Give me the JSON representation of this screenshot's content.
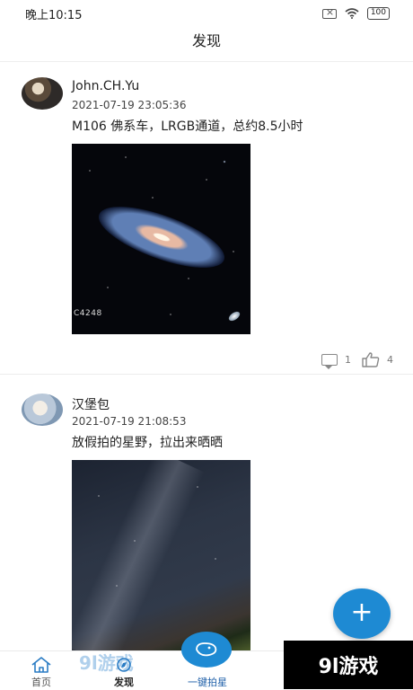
{
  "status_bar": {
    "time": "晚上10:15",
    "battery": "100"
  },
  "header": {
    "title": "发现"
  },
  "posts": [
    {
      "username": "John.CH.Yu",
      "timestamp": "2021-07-19 23:05:36",
      "caption": "M106 佛系车，LRGB通道，总约8.5小时",
      "photo_label": "C4248",
      "comments": "1",
      "likes": "4"
    },
    {
      "username": "汉堡包",
      "timestamp": "2021-07-19 21:08:53",
      "caption": "放假拍的星野，拉出来晒晒"
    }
  ],
  "fab": {
    "label": "+"
  },
  "tabbar": {
    "home": "首页",
    "discover": "发现",
    "shoot": "一键拍星"
  },
  "watermark": {
    "text": "9l游戏",
    "left_text": "9l游戏"
  },
  "colors": {
    "accent": "#1e8ad3"
  }
}
